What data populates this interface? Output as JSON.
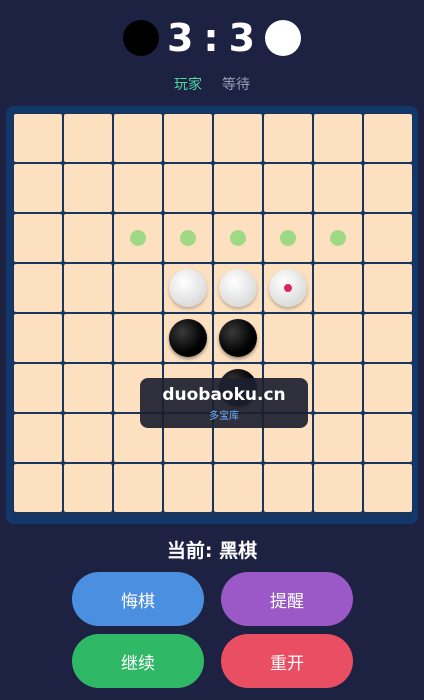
{
  "score": {
    "black": "3",
    "separator": ":",
    "white": "3"
  },
  "status": {
    "player": "玩家",
    "waiting": "等待"
  },
  "board": {
    "size": 8,
    "colors": {
      "cell": "#fde0c0",
      "grid": "#17365d",
      "hint": "#8fd77a",
      "last_move_marker": "#e0245e"
    },
    "rows": [
      [
        "",
        "",
        "",
        "",
        "",
        "",
        "",
        ""
      ],
      [
        "",
        "",
        "",
        "",
        "",
        "",
        "",
        ""
      ],
      [
        "",
        "",
        "hint",
        "hint",
        "hint",
        "hint",
        "hint",
        ""
      ],
      [
        "",
        "",
        "",
        "white",
        "white",
        "white-last",
        "",
        ""
      ],
      [
        "",
        "",
        "",
        "black",
        "black",
        "",
        "",
        ""
      ],
      [
        "",
        "",
        "",
        "",
        "black",
        "",
        "",
        ""
      ],
      [
        "",
        "",
        "",
        "",
        "",
        "",
        "",
        ""
      ],
      [
        "",
        "",
        "",
        "",
        "",
        "",
        "",
        ""
      ]
    ]
  },
  "watermark": {
    "main": "duobaoku.cn",
    "sub": "多宝库"
  },
  "current": {
    "text": "当前: 黑棋"
  },
  "buttons": {
    "undo": "悔棋",
    "hint": "提醒",
    "continue": "继续",
    "restart": "重开"
  }
}
